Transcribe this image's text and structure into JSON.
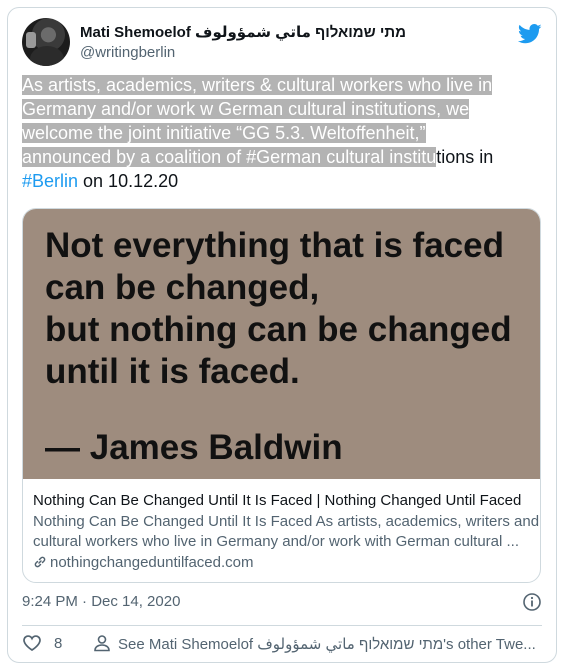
{
  "author": {
    "display_name": "Mati Shemoelof מתי שמואלוף ماتي شمؤولوف",
    "handle": "@writingberlin"
  },
  "tweet": {
    "lines": [
      {
        "highlighted": "As artists, academics, writers & cultural workers who live in",
        "rest": ""
      },
      {
        "highlighted": "Germany and/or work w German cultural institutions, we",
        "rest": ""
      },
      {
        "highlighted": "welcome the joint initiative “GG 5.3. Weltoffenheit,”",
        "rest": ""
      },
      {
        "highlighted": "announced by a coalition of #German cultural institu",
        "rest": "tions in"
      }
    ],
    "last_line": {
      "hashtag": "#Berlin",
      "text": " on 10.12.20"
    }
  },
  "card": {
    "image_quote_lines": [
      "Not everything that is faced",
      "can be changed,",
      "but nothing can be changed",
      "until it is faced."
    ],
    "image_author": "— James Baldwin",
    "image_bg_color": "#9e8c7e",
    "title": "Nothing Can Be Changed Until It Is Faced | Nothing Changed Until Faced",
    "description_lines": [
      "Nothing Can Be Changed Until It Is Faced As artists, academics, writers and",
      "cultural workers who live in Germany and/or work with German cultural ..."
    ],
    "link": "nothingchangeduntilfaced.com"
  },
  "timestamp": "9:24 PM · Dec 14, 2020",
  "footer": {
    "like_count": "8",
    "other_tweets": "See Mati Shemoelof מתי שמואלוף ماتي شمؤولوف's other Twe..."
  },
  "colors": {
    "accent": "#1d9bf0",
    "secondary_text": "#536471",
    "highlight": "#b3b3b3"
  }
}
